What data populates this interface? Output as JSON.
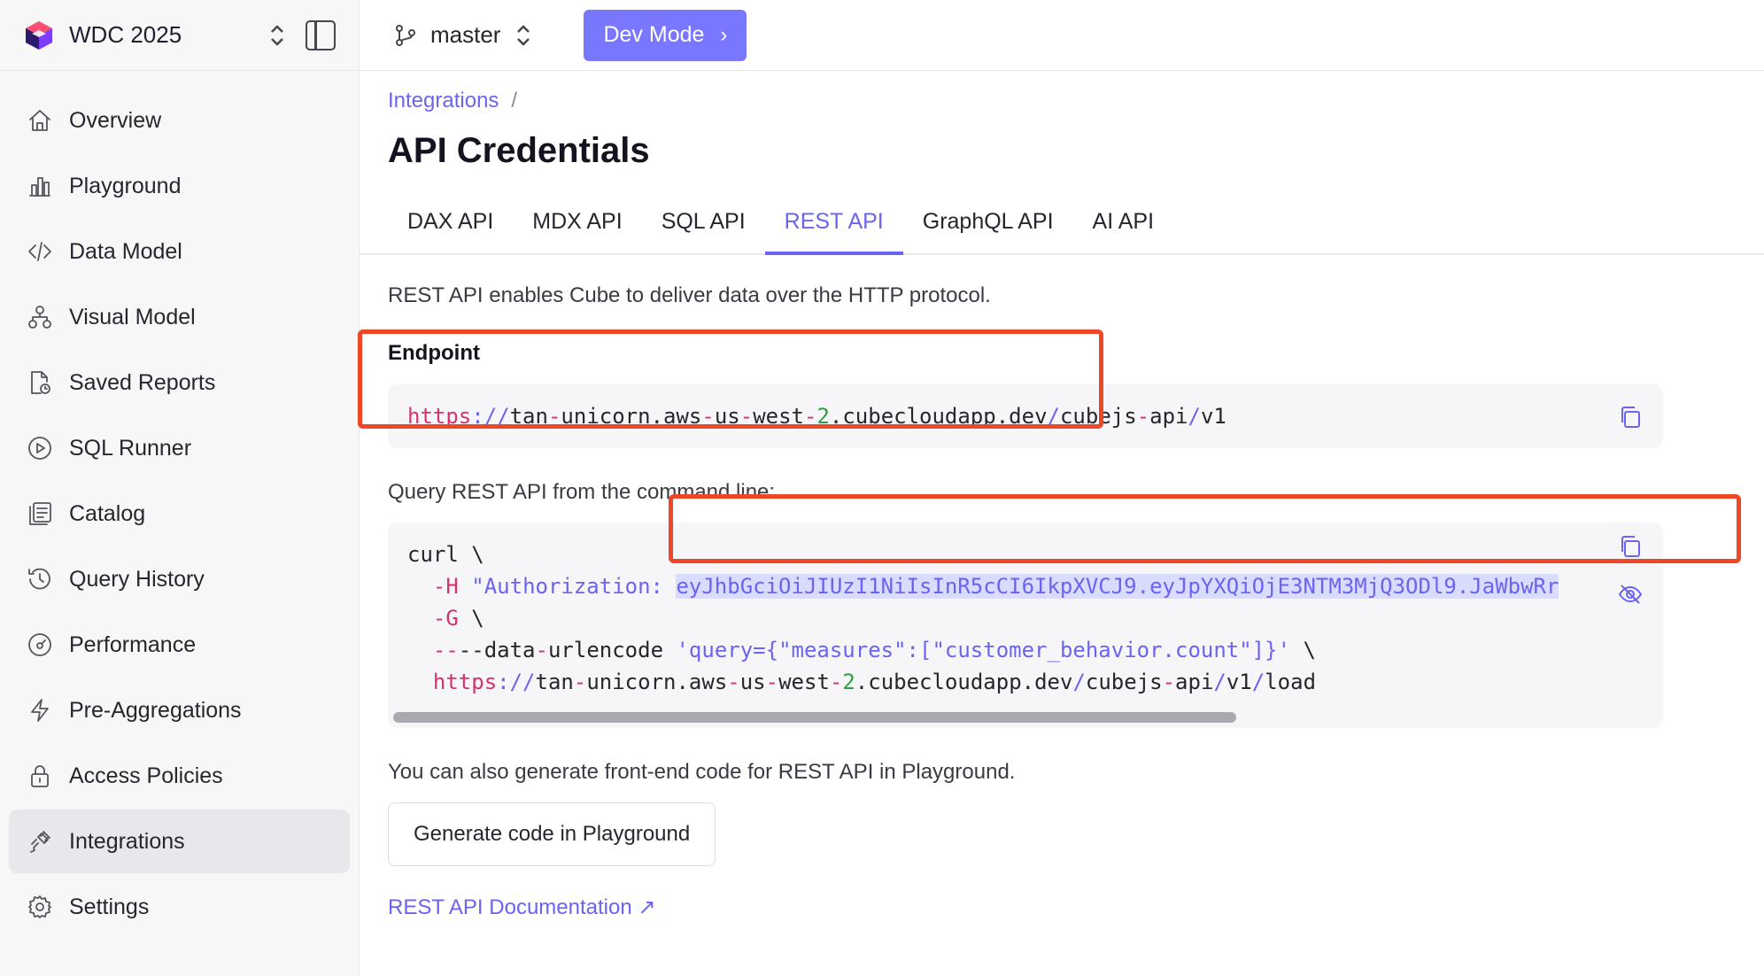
{
  "workspace": {
    "name": "WDC 2025"
  },
  "sidebar": {
    "items": [
      {
        "label": "Overview",
        "icon": "home-icon"
      },
      {
        "label": "Playground",
        "icon": "bar-chart-icon"
      },
      {
        "label": "Data Model",
        "icon": "code-icon"
      },
      {
        "label": "Visual Model",
        "icon": "hierarchy-icon"
      },
      {
        "label": "Saved Reports",
        "icon": "saved-report-icon"
      },
      {
        "label": "SQL Runner",
        "icon": "play-circle-icon"
      },
      {
        "label": "Catalog",
        "icon": "catalog-icon"
      },
      {
        "label": "Query History",
        "icon": "history-icon"
      },
      {
        "label": "Performance",
        "icon": "gauge-icon"
      },
      {
        "label": "Pre-Aggregations",
        "icon": "lightning-icon"
      },
      {
        "label": "Access Policies",
        "icon": "lock-icon"
      },
      {
        "label": "Integrations",
        "icon": "plug-icon",
        "active": true
      },
      {
        "label": "Settings",
        "icon": "gear-icon"
      }
    ]
  },
  "topbar": {
    "branch": "master",
    "dev_mode": "Dev Mode"
  },
  "breadcrumb": {
    "parent": "Integrations",
    "separator": "/"
  },
  "page": {
    "title": "API Credentials"
  },
  "tabs": [
    {
      "label": "DAX API"
    },
    {
      "label": "MDX API"
    },
    {
      "label": "SQL API"
    },
    {
      "label": "REST API",
      "active": true
    },
    {
      "label": "GraphQL API"
    },
    {
      "label": "AI API"
    }
  ],
  "rest": {
    "description": "REST API enables Cube to deliver data over the HTTP protocol.",
    "endpoint_label": "Endpoint",
    "endpoint": {
      "scheme": "https",
      "sep": "://",
      "host_a": "tan",
      "host_b": "unicorn.aws",
      "host_c": "us",
      "host_d": "west",
      "host_num": "2",
      "host_e": ".cubecloudapp.dev",
      "path_a": "/",
      "path_b": "cubejs",
      "path_c": "api",
      "path_d": "/",
      "path_e": "v1"
    },
    "query_label": "Query REST API from the command line:",
    "curl": {
      "line1": "curl \\",
      "h_flag": "-H",
      "auth_prefix": "\"Authorization: ",
      "token": "eyJhbGciOiJIUzI1NiIsInR5cCI6IkpXVCJ9.eyJpYXQiOjE3NTM3MjQ3ODl9.JaWbwRr",
      "g_flag": "-G",
      "g_rest": " \\",
      "data_flag": "--data",
      "data_word": "urlencode",
      "data_arg": "'query={\"measures\":[\"customer_behavior.count\"]}'",
      "data_tail": " \\",
      "url_scheme": "https",
      "url_sep": "://",
      "url_host_a": "tan",
      "url_host_b": "unicorn.aws",
      "url_host_c": "us",
      "url_host_d": "west",
      "url_num": "2",
      "url_host_e": ".cubecloudapp.dev",
      "url_path_a": "/",
      "url_path_b": "cubejs",
      "url_path_c": "api",
      "url_path_d": "/",
      "url_path_e": "v1",
      "url_path_f": "/",
      "url_path_g": "load"
    },
    "also_text": "You can also generate front-end code for REST API in Playground.",
    "generate_button": "Generate code in Playground",
    "doc_link": "REST API Documentation ↗"
  },
  "colors": {
    "accent": "#6a64f1",
    "dev_mode_bg": "#7a77ff",
    "annotation": "#ee4728",
    "string_red": "#d6336c",
    "number_green": "#2f9e44"
  }
}
